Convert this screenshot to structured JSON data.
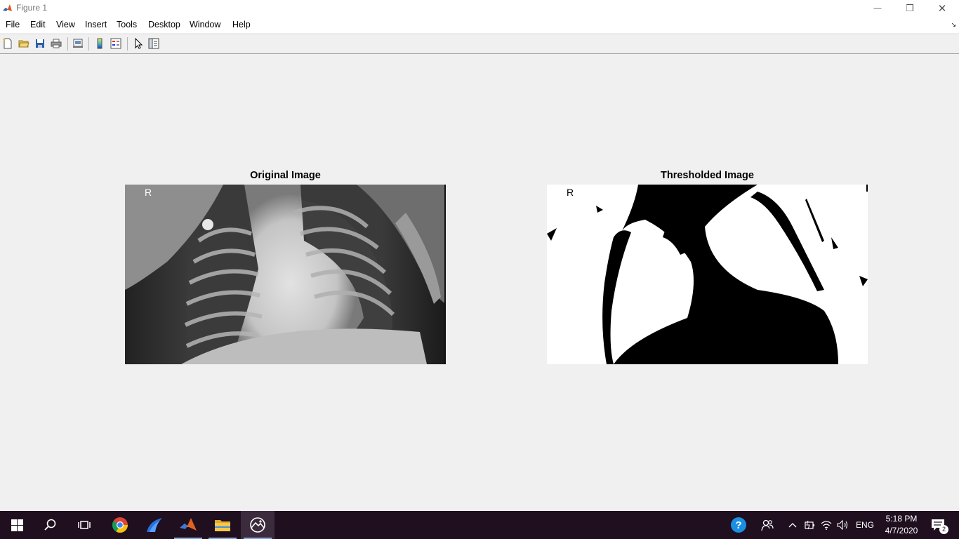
{
  "window": {
    "title": "Figure 1",
    "controls": {
      "minimize": "—",
      "restore": "❐",
      "close": "✕"
    }
  },
  "menu": {
    "items": [
      "File",
      "Edit",
      "View",
      "Insert",
      "Tools",
      "Desktop",
      "Window",
      "Help"
    ],
    "collapse_glyph": "↘"
  },
  "toolbar": {
    "buttons": [
      "new-figure",
      "open-file",
      "save",
      "print",
      "print-preview",
      "insert-colorbar",
      "insert-legend",
      "edit-plot",
      "plot-tools"
    ]
  },
  "figure": {
    "left_axes": {
      "title": "Original Image",
      "marker_letter": "R"
    },
    "right_axes": {
      "title": "Thresholded Image",
      "marker_letter": "R"
    }
  },
  "taskbar": {
    "apps": [
      "start",
      "search",
      "task-view",
      "chrome",
      "wing-ide",
      "matlab",
      "file-explorer",
      "image-viewer"
    ],
    "language": "ENG",
    "time": "5:18 PM",
    "date": "4/7/2020",
    "notification_count": "2",
    "colors": {
      "background": "#1f0f1f",
      "accent": "#8aa8e0"
    }
  }
}
